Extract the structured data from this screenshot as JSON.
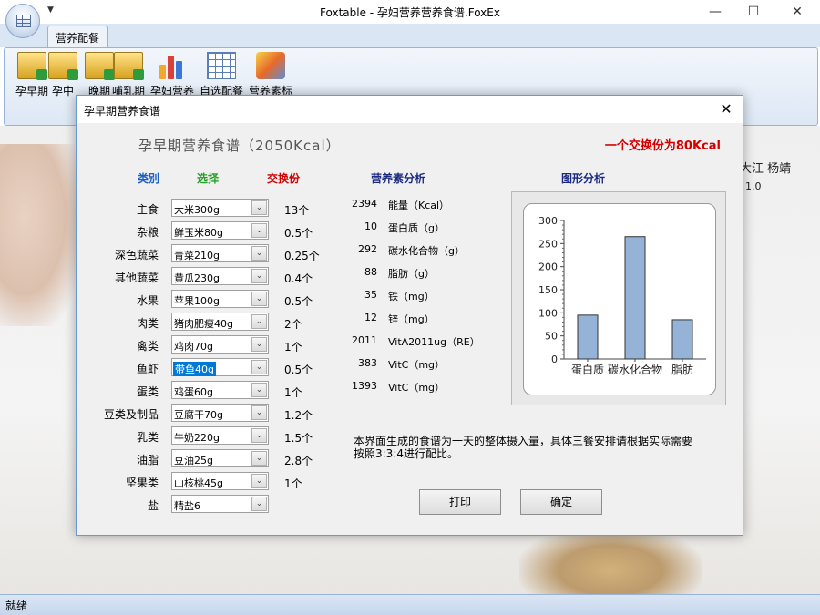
{
  "window": {
    "title": "Foxtable - 孕妇营养营养食谱.FoxEx"
  },
  "ribbon": {
    "tab": "营养配餐",
    "buttons": [
      {
        "label": "孕早期",
        "icon": "document-icon"
      },
      {
        "label": "孕中",
        "icon": "document-icon"
      },
      {
        "label": "晚期",
        "icon": "document-icon"
      },
      {
        "label": "哺乳期",
        "icon": "document-icon"
      },
      {
        "label": "孕妇营养",
        "icon": "bar-chart-icon"
      },
      {
        "label": "自选配餐",
        "icon": "table-icon"
      },
      {
        "label": "营养素标",
        "icon": "box-icon"
      }
    ]
  },
  "background": {
    "names": "大江 杨靖",
    "value": "1.0"
  },
  "status": {
    "text": "就绪"
  },
  "dialog": {
    "title": "孕早期营养食谱",
    "heading": "孕早期营养食谱（2050Kcal）",
    "exchange_note": "一个交换份为80Kcal",
    "headers": {
      "category": "类别",
      "choice": "选择",
      "portion": "交换份",
      "analysis": "营养素分析",
      "chart": "图形分析"
    },
    "foods": [
      {
        "category": "主食",
        "choice": "大米300g",
        "portion": "13个"
      },
      {
        "category": "杂粮",
        "choice": "鲜玉米80g",
        "portion": "0.5个"
      },
      {
        "category": "深色蔬菜",
        "choice": "青菜210g",
        "portion": "0.25个"
      },
      {
        "category": "其他蔬菜",
        "choice": "黄瓜230g",
        "portion": "0.4个"
      },
      {
        "category": "水果",
        "choice": "苹果100g",
        "portion": "0.5个"
      },
      {
        "category": "肉类",
        "choice": "猪肉肥瘦40g",
        "portion": "2个"
      },
      {
        "category": "禽类",
        "choice": "鸡肉70g",
        "portion": "1个"
      },
      {
        "category": "鱼虾",
        "choice": "带鱼40g",
        "portion": "0.5个"
      },
      {
        "category": "蛋类",
        "choice": "鸡蛋60g",
        "portion": "1个"
      },
      {
        "category": "豆类及制品",
        "choice": "豆腐干70g",
        "portion": "1.2个"
      },
      {
        "category": "乳类",
        "choice": "牛奶220g",
        "portion": "1.5个"
      },
      {
        "category": "油脂",
        "choice": "豆油25g",
        "portion": "2.8个"
      },
      {
        "category": "坚果类",
        "choice": "山核桃45g",
        "portion": "1个"
      },
      {
        "category": "盐",
        "choice": "精盐6",
        "portion": ""
      }
    ],
    "nutrients": [
      {
        "value": "2394",
        "name": "能量（Kcal）"
      },
      {
        "value": "10",
        "name": "蛋白质（g）"
      },
      {
        "value": "292",
        "name": "碳水化合物（g）"
      },
      {
        "value": "88",
        "name": "脂肪（g）"
      },
      {
        "value": "35",
        "name": "铁（mg）"
      },
      {
        "value": "12",
        "name": "锌（mg）"
      },
      {
        "value": "2011",
        "name": "VitA2011ug（RE）"
      },
      {
        "value": "383",
        "name": "VitC（mg）"
      },
      {
        "value": "1393",
        "name": "VitC（mg）"
      }
    ],
    "note": "本界面生成的食谱为一天的整体摄入量，具体三餐安排请根据实际需要按照3:3:4进行配比。",
    "buttons": {
      "print": "打印",
      "ok": "确定"
    }
  },
  "chart_data": {
    "type": "bar",
    "categories": [
      "蛋白质",
      "碳水化合物",
      "脂肪"
    ],
    "values": [
      95,
      265,
      85
    ],
    "ylim": [
      0,
      300
    ],
    "yticks": [
      0,
      50,
      100,
      150,
      200,
      250,
      300
    ],
    "grid": false,
    "bar_color": "#95b3d7"
  },
  "colors": {
    "category_header": "#1c5fc4",
    "choice_header": "#2aa02a",
    "portion_header": "#d40000",
    "analysis_header": "#1a2a80",
    "chart_header": "#1a2a80"
  }
}
